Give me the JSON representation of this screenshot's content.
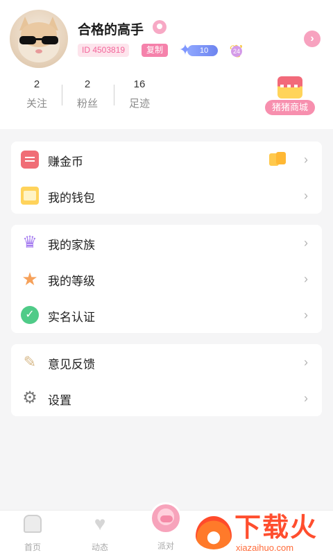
{
  "profile": {
    "username": "合格的高手",
    "id_text": "ID 4503819",
    "copy_label": "复制",
    "level_number": "10",
    "medal_number": "24"
  },
  "stats": [
    {
      "value": "2",
      "label": "关注"
    },
    {
      "value": "2",
      "label": "粉丝"
    },
    {
      "value": "16",
      "label": "足迹"
    }
  ],
  "mall": {
    "label": "猪猪商城"
  },
  "menu_groups": [
    {
      "items": [
        {
          "label": "赚金币",
          "icon": "coin-icon"
        },
        {
          "label": "我的钱包",
          "icon": "wallet-icon"
        }
      ]
    },
    {
      "items": [
        {
          "label": "我的家族",
          "icon": "crown-icon"
        },
        {
          "label": "我的等级",
          "icon": "star-icon"
        },
        {
          "label": "实名认证",
          "icon": "verified-check-icon"
        }
      ]
    },
    {
      "items": [
        {
          "label": "意见反馈",
          "icon": "feedback-pencil-icon"
        },
        {
          "label": "设置",
          "icon": "settings-gear-icon"
        }
      ]
    }
  ],
  "tabbar": {
    "tabs": [
      {
        "label": "首页",
        "icon": "home-icon"
      },
      {
        "label": "动态",
        "icon": "heart-icon"
      },
      {
        "label": "派对",
        "icon": "pig-avatar-icon"
      }
    ]
  },
  "watermark": {
    "text": "下载火",
    "subtext": "xiazaihuo.com"
  },
  "colors": {
    "accent_pink": "#f582ab",
    "background": "#f5f5f6"
  }
}
